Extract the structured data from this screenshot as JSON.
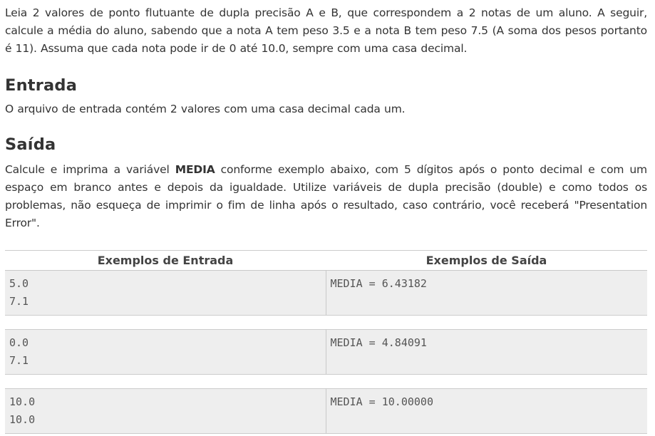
{
  "intro": "Leia 2 valores de ponto flutuante de dupla precisão A e B, que correspondem a 2 notas de um aluno. A seguir, calcule a média do aluno, sabendo que a nota A tem peso 3.5 e a nota B tem peso 7.5 (A soma dos pesos portanto é 11). Assuma que cada nota pode ir de 0 até 10.0, sempre com uma casa decimal.",
  "entrada": {
    "heading": "Entrada",
    "text": "O arquivo de entrada contém 2 valores com uma casa decimal cada um."
  },
  "saida": {
    "heading": "Saída",
    "text_before": "Calcule e imprima a variável ",
    "text_bold": "MEDIA",
    "text_after": " conforme exemplo abaixo, com 5 dígitos após o ponto decimal e com um espaço em branco antes e depois da igualdade. Utilize variáveis de dupla precisão (double) e como todos os problemas, não esqueça de imprimir o fim de linha após o resultado, caso contrário, você receberá \"Presentation Error\"."
  },
  "examples": {
    "input_header": "Exemplos de Entrada",
    "output_header": "Exemplos de Saída",
    "rows": [
      {
        "input": [
          "5.0",
          "7.1"
        ],
        "output": "MEDIA = 6.43182"
      },
      {
        "input": [
          "0.0",
          "7.1"
        ],
        "output": "MEDIA = 4.84091"
      },
      {
        "input": [
          "10.0",
          "10.0"
        ],
        "output": "MEDIA = 10.00000"
      }
    ]
  }
}
